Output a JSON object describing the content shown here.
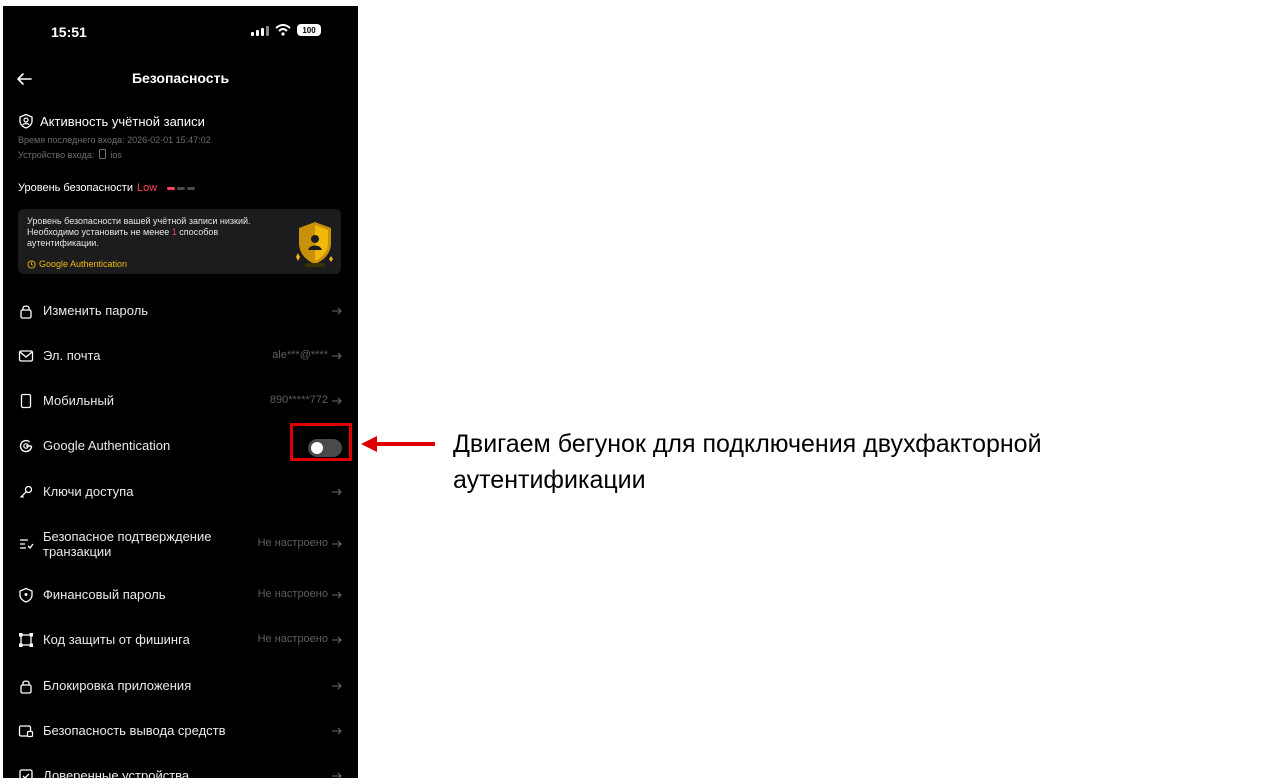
{
  "status": {
    "time": "15:51",
    "battery": "100"
  },
  "nav": {
    "title": "Безопасность",
    "back_icon": "arrow-left-icon"
  },
  "account_activity": {
    "title": "Активность учётной записи",
    "last_login_label": "Время последнего входа:",
    "last_login_value": "2026-02-01 15:47:02",
    "device_label": "Устройство входа:",
    "device_value": "ios"
  },
  "security_level": {
    "label": "Уровень безопасности",
    "value": "Low",
    "bars_filled": 1,
    "bars_total": 3
  },
  "warning": {
    "text_before": "Уровень безопасности вашей учётной записи низкий. Необходимо установить не менее ",
    "count": "1",
    "text_after": " способов аутентификации.",
    "link": "Google Authentication"
  },
  "menu": [
    {
      "label": "Изменить пароль",
      "value": "",
      "icon": "lock-icon"
    },
    {
      "label": "Эл. почта",
      "value": "ale***@****",
      "icon": "envelope-icon"
    },
    {
      "label": "Мобильный",
      "value": "890*****772",
      "icon": "phone-icon"
    },
    {
      "label": "Google Authentication",
      "value": "",
      "icon": "google-auth-icon",
      "toggle": false
    },
    {
      "label": "Ключи доступа",
      "value": "",
      "icon": "key-icon"
    },
    {
      "label": "Безопасное подтверждение транзакции",
      "value": "Не настроено",
      "icon": "transaction-confirm-icon"
    },
    {
      "label": "Финансовый пароль",
      "value": "Не настроено",
      "icon": "shield-icon"
    },
    {
      "label": "Код защиты от фишинга",
      "value": "Не настроено",
      "icon": "anti-phishing-icon"
    },
    {
      "label": "Блокировка приложения",
      "value": "",
      "icon": "lock-icon"
    },
    {
      "label": "Безопасность вывода средств",
      "value": "",
      "icon": "withdrawal-icon"
    },
    {
      "label": "Доверенные устройства",
      "value": "",
      "icon": "checkbox-icon"
    }
  ],
  "annotation": {
    "text": "Двигаем бегунок для подключения двухфакторной аутентификации"
  },
  "colors": {
    "background": "#000000",
    "accent": "#f0b90b",
    "danger": "#f6465d",
    "highlight": "#e10000"
  }
}
